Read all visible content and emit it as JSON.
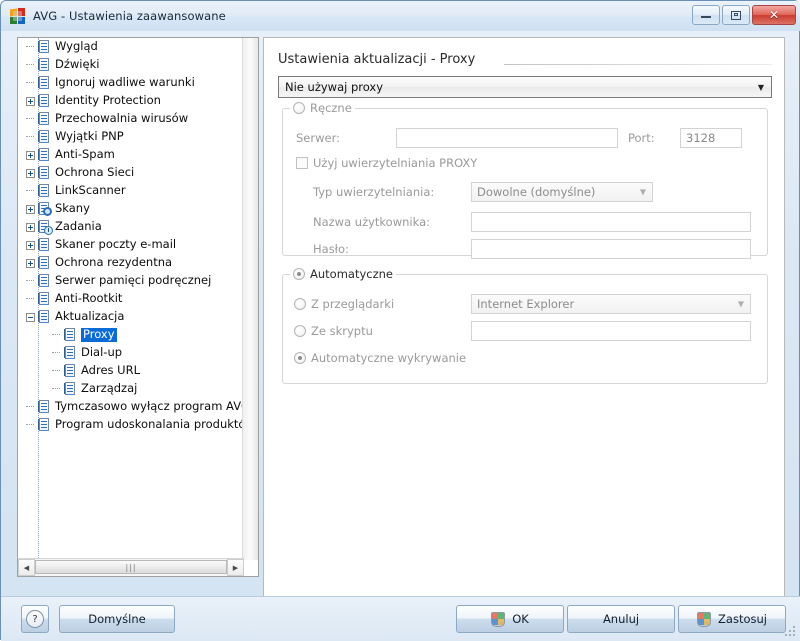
{
  "window": {
    "title": "AVG - Ustawienia zaawansowane",
    "logo_icon": "avg-logo-icon",
    "minimize_icon": "minimize-icon",
    "restore_icon": "restore-icon",
    "close_icon": "close-icon"
  },
  "tree": {
    "items": [
      {
        "label": "Wygląd",
        "level": 1,
        "expander": "none",
        "icon": "document-icon"
      },
      {
        "label": "Dźwięki",
        "level": 1,
        "expander": "none",
        "icon": "document-icon"
      },
      {
        "label": "Ignoruj wadliwe warunki",
        "level": 1,
        "expander": "none",
        "icon": "document-icon"
      },
      {
        "label": "Identity Protection",
        "level": 1,
        "expander": "plus",
        "icon": "document-icon"
      },
      {
        "label": "Przechowalnia wirusów",
        "level": 1,
        "expander": "none",
        "icon": "document-icon"
      },
      {
        "label": "Wyjątki PNP",
        "level": 1,
        "expander": "none",
        "icon": "document-icon"
      },
      {
        "label": "Anti-Spam",
        "level": 1,
        "expander": "plus",
        "icon": "document-icon"
      },
      {
        "label": "Ochrona Sieci",
        "level": 1,
        "expander": "plus",
        "icon": "document-icon"
      },
      {
        "label": "LinkScanner",
        "level": 1,
        "expander": "none",
        "icon": "document-icon"
      },
      {
        "label": "Skany",
        "level": 1,
        "expander": "plus",
        "icon": "magnifier-icon"
      },
      {
        "label": "Zadania",
        "level": 1,
        "expander": "plus",
        "icon": "clock-icon"
      },
      {
        "label": "Skaner poczty e-mail",
        "level": 1,
        "expander": "plus",
        "icon": "document-icon"
      },
      {
        "label": "Ochrona rezydentna",
        "level": 1,
        "expander": "plus",
        "icon": "document-icon"
      },
      {
        "label": "Serwer pamięci podręcznej",
        "level": 1,
        "expander": "none",
        "icon": "document-icon"
      },
      {
        "label": "Anti-Rootkit",
        "level": 1,
        "expander": "none",
        "icon": "document-icon"
      },
      {
        "label": "Aktualizacja",
        "level": 1,
        "expander": "minus",
        "icon": "document-icon"
      },
      {
        "label": "Proxy",
        "level": 2,
        "expander": "none",
        "icon": "document-icon",
        "selected": true
      },
      {
        "label": "Dial-up",
        "level": 2,
        "expander": "none",
        "icon": "document-icon"
      },
      {
        "label": "Adres URL",
        "level": 2,
        "expander": "none",
        "icon": "document-icon"
      },
      {
        "label": "Zarządzaj",
        "level": 2,
        "expander": "none",
        "icon": "document-icon"
      },
      {
        "label": "Tymczasowo wyłącz program AVG",
        "level": 1,
        "expander": "none",
        "icon": "document-icon"
      },
      {
        "label": "Program udoskonalania produktów",
        "level": 1,
        "expander": "none",
        "icon": "document-icon"
      }
    ],
    "hscroll": {
      "left_arrow": "scroll-left-icon",
      "right_arrow": "scroll-right-icon",
      "grip": "|||"
    }
  },
  "panel": {
    "title": "Ustawienia aktualizacji - Proxy",
    "mode_combo": {
      "value": "Nie używaj proxy",
      "arrow_icon": "chevron-down-icon"
    },
    "manual": {
      "legend": "Ręczne",
      "selected": false,
      "server_label": "Serwer:",
      "server_value": "",
      "port_label": "Port:",
      "port_value": "3128",
      "auth_checkbox_label": "Użyj uwierzytelniania PROXY",
      "auth_checked": false,
      "auth_type_label": "Typ uwierzytelniania:",
      "auth_type_value": "Dowolne (domyślne)",
      "username_label": "Nazwa użytkownika:",
      "username_value": "",
      "password_label": "Hasło:",
      "password_value": ""
    },
    "automatic": {
      "legend": "Automatyczne",
      "selected": true,
      "from_browser_label": "Z przeglądarki",
      "from_browser_selected": false,
      "browser_value": "Internet Explorer",
      "from_script_label": "Ze skryptu",
      "from_script_selected": false,
      "script_value": "",
      "autodetect_label": "Automatyczne wykrywanie",
      "autodetect_selected": true
    }
  },
  "footer": {
    "help_icon": "question-mark-icon",
    "defaults_label": "Domyślne",
    "ok_label": "OK",
    "cancel_label": "Anuluj",
    "apply_label": "Zastosuj",
    "shield_icon": "uac-shield-icon"
  }
}
